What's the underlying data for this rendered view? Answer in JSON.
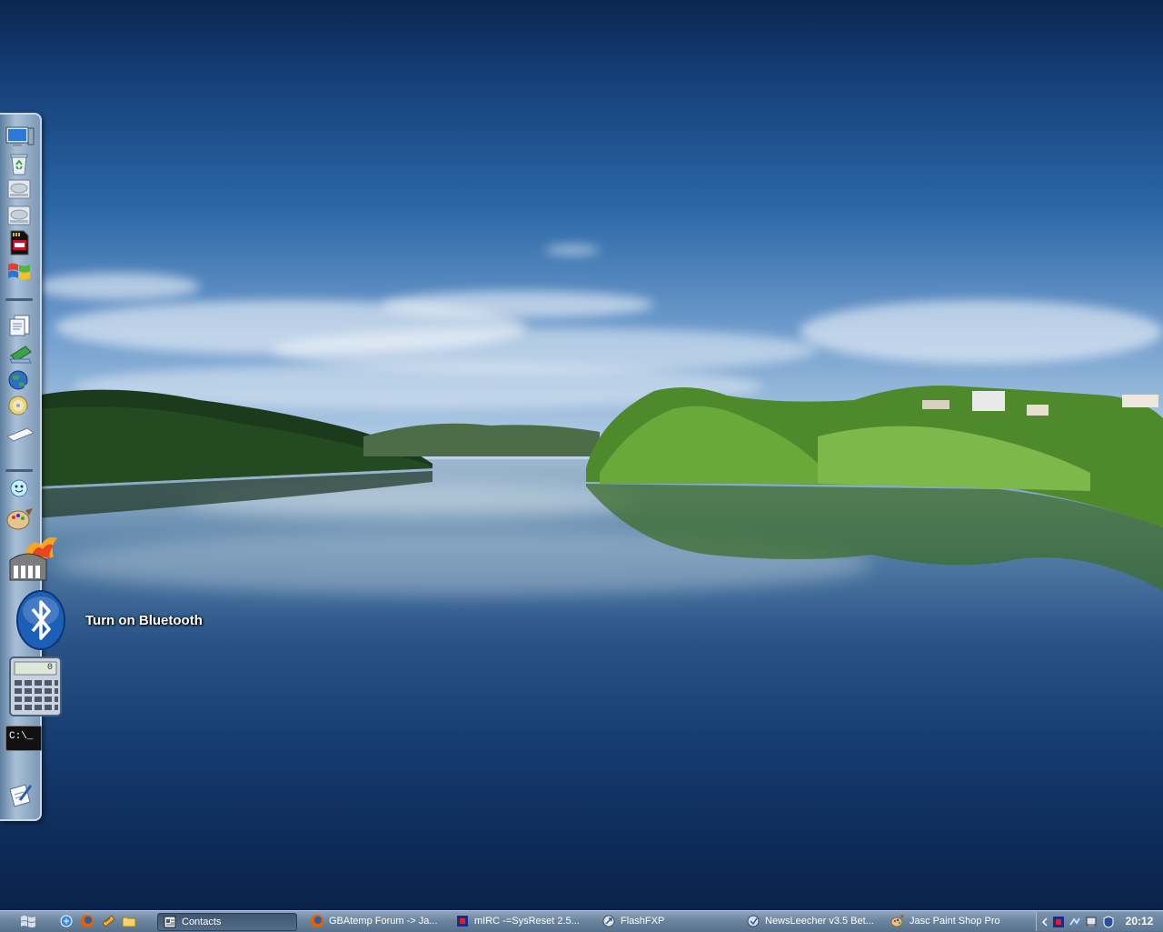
{
  "desktop": {
    "wallpaper": "lake-landscape",
    "bluetooth_tooltip": "Turn on Bluetooth"
  },
  "dock": {
    "icons": [
      {
        "name": "my-computer-icon"
      },
      {
        "name": "recycle-bin-icon"
      },
      {
        "name": "hard-drive-icon"
      },
      {
        "name": "hard-drive-icon"
      },
      {
        "name": "sd-card-icon"
      },
      {
        "name": "windows-icon"
      },
      {
        "name": "documents-icon"
      },
      {
        "name": "notes-icon"
      },
      {
        "name": "internet-globe-icon"
      },
      {
        "name": "cd-icon"
      },
      {
        "name": "keyboard-icon"
      },
      {
        "name": "messenger-icon"
      },
      {
        "name": "paint-palette-icon"
      },
      {
        "name": "burning-tool-icon"
      },
      {
        "name": "bluetooth-icon"
      },
      {
        "name": "calculator-icon"
      },
      {
        "name": "command-prompt-icon"
      },
      {
        "name": "notepad-icon"
      }
    ],
    "cmd_text": "C:\\_",
    "calc_display": "0"
  },
  "taskbar": {
    "quick_launch": [
      "internet-explorer-icon",
      "firefox-icon",
      "media-icon",
      "folder-icon"
    ],
    "tasks": [
      {
        "label": "Contacts",
        "icon": "contacts-icon",
        "active": true
      },
      {
        "label": "GBAtemp Forum -> Ja...",
        "icon": "firefox-icon",
        "active": false
      },
      {
        "label": "mIRC -=SysReset 2.5...",
        "icon": "mirc-icon",
        "active": false
      },
      {
        "label": "FlashFXP",
        "icon": "flashfxp-icon",
        "active": false
      },
      {
        "label": "NewsLeecher v3.5 Bet...",
        "icon": "newsleecher-icon",
        "active": false
      },
      {
        "label": "Jasc Paint Shop Pro",
        "icon": "paint-shop-pro-icon",
        "active": false
      }
    ],
    "tray_icons": [
      "tray-collapse-icon",
      "tray-mirc-icon",
      "tray-network-icon",
      "tray-volume-icon",
      "tray-security-icon"
    ],
    "clock": "20:12"
  },
  "colors": {
    "taskbar": "#6d86a0",
    "sky_top": "#0b2650",
    "water_deep": "#0e2d5b"
  }
}
